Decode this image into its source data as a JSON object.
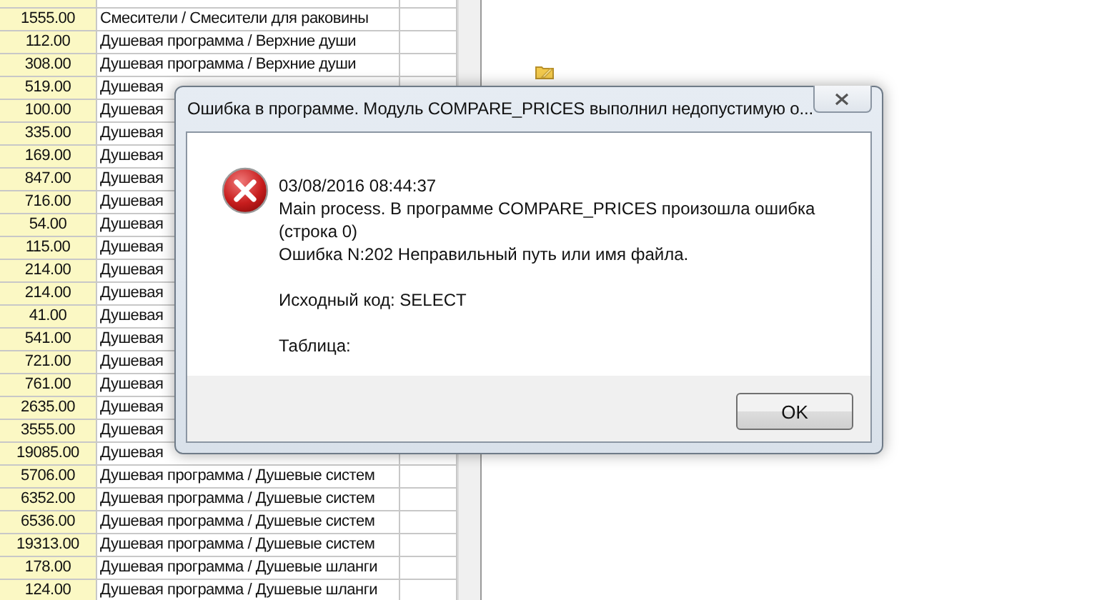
{
  "grid": {
    "rows": [
      {
        "price": "1555.00",
        "name": "Смесители / Смесители для раковины"
      },
      {
        "price": "112.00",
        "name": "Душевая программа / Верхние души"
      },
      {
        "price": "308.00",
        "name": "Душевая программа / Верхние души"
      },
      {
        "price": "519.00",
        "name": "Душевая"
      },
      {
        "price": "100.00",
        "name": "Душевая"
      },
      {
        "price": "335.00",
        "name": "Душевая"
      },
      {
        "price": "169.00",
        "name": "Душевая"
      },
      {
        "price": "847.00",
        "name": "Душевая"
      },
      {
        "price": "716.00",
        "name": "Душевая"
      },
      {
        "price": "54.00",
        "name": "Душевая"
      },
      {
        "price": "115.00",
        "name": "Душевая"
      },
      {
        "price": "214.00",
        "name": "Душевая"
      },
      {
        "price": "214.00",
        "name": "Душевая"
      },
      {
        "price": "41.00",
        "name": "Душевая"
      },
      {
        "price": "541.00",
        "name": "Душевая"
      },
      {
        "price": "721.00",
        "name": "Душевая"
      },
      {
        "price": "761.00",
        "name": "Душевая"
      },
      {
        "price": "2635.00",
        "name": "Душевая"
      },
      {
        "price": "3555.00",
        "name": "Душевая"
      },
      {
        "price": "19085.00",
        "name": "Душевая"
      },
      {
        "price": "5706.00",
        "name": "Душевая программа / Душевые систем"
      },
      {
        "price": "6352.00",
        "name": "Душевая программа / Душевые систем"
      },
      {
        "price": "6536.00",
        "name": "Душевая программа / Душевые систем"
      },
      {
        "price": "19313.00",
        "name": "Душевая программа / Душевые систем"
      },
      {
        "price": "178.00",
        "name": "Душевая программа / Душевые шланги"
      },
      {
        "price": "124.00",
        "name": "Душевая программа / Душевые шланги"
      }
    ]
  },
  "dialog": {
    "title": "Ошибка в программе. Модуль COMPARE_PRICES выполнил недопустимую о...",
    "kind": "error",
    "message": [
      [
        "03/08/2016 08:44:37",
        "Main process. В программе COMPARE_PRICES произошла ошибка",
        "(строка 0)",
        "Ошибка N:202 Неправильный путь или имя файла."
      ],
      [
        "Исходный код: SELECT"
      ],
      [
        "Таблица:"
      ]
    ],
    "buttons": [
      "OK"
    ]
  }
}
